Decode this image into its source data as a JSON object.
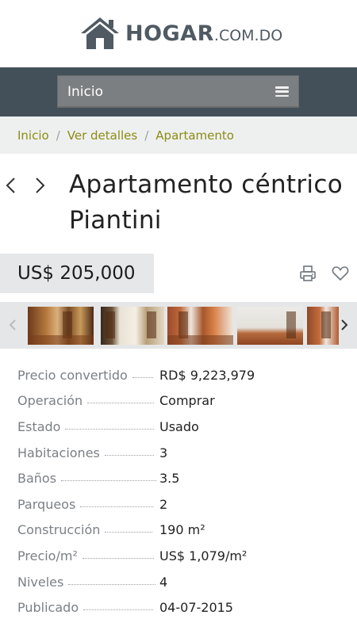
{
  "header": {
    "brand_main": "HOGAR",
    "brand_domain": ".COM.DO",
    "logo_icon": "house-icon"
  },
  "nav": {
    "selected": "Inicio",
    "menu_icon": "hamburger-icon"
  },
  "breadcrumb": {
    "items": [
      "Inicio",
      "Ver detalles",
      "Apartamento"
    ],
    "separator": "/"
  },
  "listing": {
    "title": "Apartamento céntrico Piantini",
    "price": "US$ 205,000",
    "prev_icon": "chevron-left-icon",
    "next_icon": "chevron-right-icon",
    "print_icon": "print-icon",
    "favorite_icon": "heart-icon"
  },
  "gallery": {
    "thumbnail_count": 5
  },
  "details": [
    {
      "label": "Precio convertido",
      "value": "RD$ 9,223,979"
    },
    {
      "label": "Operación",
      "value": "Comprar"
    },
    {
      "label": "Estado",
      "value": "Usado"
    },
    {
      "label": "Habitaciones",
      "value": "3"
    },
    {
      "label": "Baños",
      "value": "3.5"
    },
    {
      "label": "Parqueos",
      "value": "2"
    },
    {
      "label": "Construcción",
      "value": "190 m²"
    },
    {
      "label": "Precio/m²",
      "value": "US$ 1,079/m²"
    },
    {
      "label": "Niveles",
      "value": "4"
    },
    {
      "label": "Publicado",
      "value": "04-07-2015"
    }
  ],
  "colors": {
    "nav_bg": "#435059",
    "breadcrumb_link": "#8c8b14",
    "logo": "#4f5a62"
  }
}
